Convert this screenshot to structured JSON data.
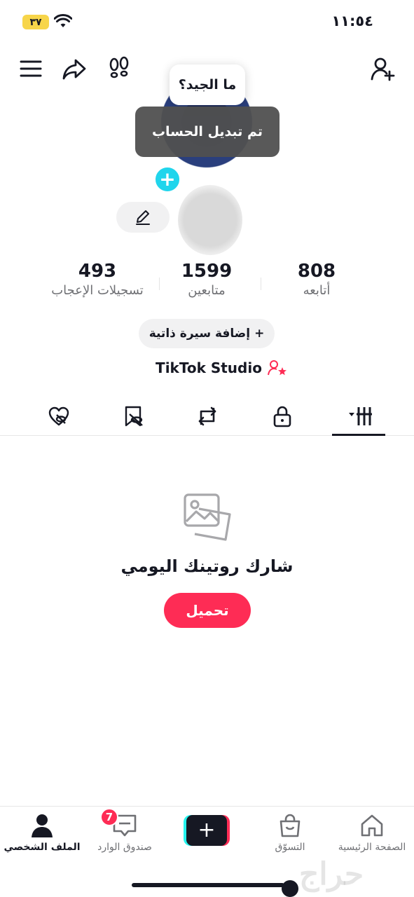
{
  "status_bar": {
    "time": "١١:٥٤",
    "battery": "٣٧"
  },
  "top_nav": {
    "icons": [
      "menu-icon",
      "share-icon",
      "footprints-icon",
      "add-friend-icon"
    ]
  },
  "tooltip": {
    "text": "ما الجيد؟"
  },
  "toast": {
    "text": "تم تبديل الحساب"
  },
  "stats": {
    "following": {
      "value": "808",
      "label": "أتابعه"
    },
    "followers": {
      "value": "1599",
      "label": "متابعين"
    },
    "likes": {
      "value": "493",
      "label": "تسجيلات الإعجاب"
    }
  },
  "bio_button": {
    "label": "إضافة سيرة ذاتية",
    "icon": "+"
  },
  "studio_link": {
    "label": "TikTok Studio"
  },
  "tabs": [
    {
      "icon": "grid-icon",
      "active": true
    },
    {
      "icon": "lock-icon",
      "active": false
    },
    {
      "icon": "repost-icon",
      "active": false
    },
    {
      "icon": "favorites-icon",
      "active": false
    },
    {
      "icon": "liked-icon",
      "active": false
    }
  ],
  "empty_state": {
    "title": "شارك روتينك اليومي",
    "button": "تحميل"
  },
  "bottom_nav": {
    "home": "الصفحة الرئيسية",
    "shop": "التسوّق",
    "create": "+",
    "inbox": "صندوق الوارد",
    "inbox_badge": "7",
    "profile": "الملف الشخصي"
  },
  "watermark": "حراج",
  "colors": {
    "accent": "#fe2c55",
    "teal": "#20d5ec",
    "text": "#161823",
    "muted": "#6f7074"
  }
}
